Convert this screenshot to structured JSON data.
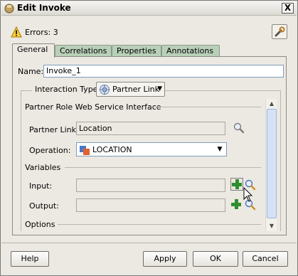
{
  "window": {
    "title": "Edit Invoke",
    "close_label": "X"
  },
  "errors": {
    "text": "Errors: 3"
  },
  "tabs": [
    {
      "label": "General",
      "active": true
    },
    {
      "label": "Correlations",
      "active": false
    },
    {
      "label": "Properties",
      "active": false
    },
    {
      "label": "Annotations",
      "active": false
    }
  ],
  "name": {
    "label": "Name:",
    "value": "Invoke_1"
  },
  "interaction": {
    "label": "Interaction Type:",
    "value": "Partner Link"
  },
  "partner_role": {
    "header": "Partner Role Web Service Interface"
  },
  "partner_link": {
    "label": "Partner Link:",
    "value": "Location"
  },
  "operation": {
    "label": "Operation:",
    "value": "LOCATION"
  },
  "variables": {
    "header": "Variables",
    "input_label": "Input:",
    "input_value": "",
    "output_label": "Output:",
    "output_value": ""
  },
  "options": {
    "header": "Options"
  },
  "buttons": {
    "help": "Help",
    "apply": "Apply",
    "ok": "OK",
    "cancel": "Cancel"
  }
}
